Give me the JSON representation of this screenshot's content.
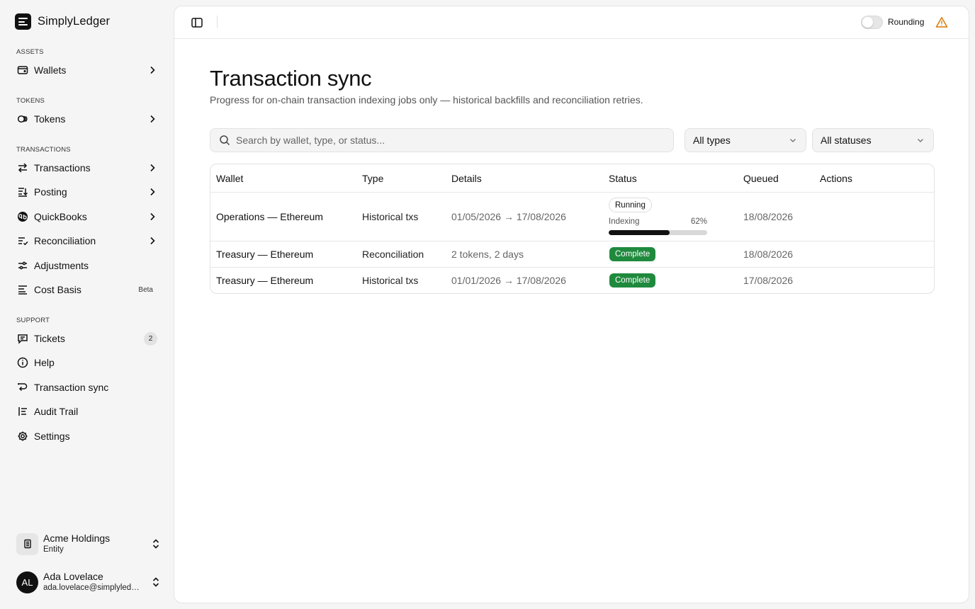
{
  "brand": {
    "name": "SimplyLedger"
  },
  "sidebar": {
    "sections": {
      "assets": "ASSETS",
      "tokens": "TOKENS",
      "transactions": "TRANSACTIONS",
      "support": "SUPPORT"
    },
    "items": {
      "wallets": "Wallets",
      "tokens": "Tokens",
      "transactions": "Transactions",
      "posting": "Posting",
      "quickbooks": "QuickBooks",
      "reconciliation": "Reconciliation",
      "adjustments": "Adjustments",
      "cost_basis": "Cost Basis",
      "cost_basis_badge": "Beta",
      "tickets": "Tickets",
      "tickets_count": "2",
      "help": "Help",
      "transaction_sync": "Transaction sync",
      "audit_trail": "Audit Trail",
      "settings": "Settings"
    },
    "entity": {
      "name": "Acme Holdings",
      "type": "Entity"
    },
    "user": {
      "initials": "AL",
      "name": "Ada Lovelace",
      "email": "ada.lovelace@simplyledger.io"
    }
  },
  "topbar": {
    "rounding_label": "Rounding"
  },
  "page": {
    "title": "Transaction sync",
    "subtitle": "Progress for on-chain transaction indexing jobs only — historical backfills and reconciliation retries."
  },
  "filters": {
    "search_placeholder": "Search by wallet, type, or status...",
    "type_value": "All types",
    "status_value": "All statuses"
  },
  "table": {
    "headers": {
      "wallet": "Wallet",
      "type": "Type",
      "details": "Details",
      "status": "Status",
      "queued": "Queued",
      "actions": "Actions"
    },
    "rows": [
      {
        "wallet": "Operations — Ethereum",
        "type": "Historical txs",
        "details": "01/05/2026 → 17/08/2026",
        "status": "Running",
        "progress_label": "Indexing",
        "progress_text": "62%",
        "progress": 0.62,
        "queued": "18/08/2026"
      },
      {
        "wallet": "Treasury — Ethereum",
        "type": "Reconciliation",
        "details": "2 tokens, 2 days",
        "status": "Complete",
        "queued": "18/08/2026"
      },
      {
        "wallet": "Treasury — Ethereum",
        "type": "Historical txs",
        "details": "01/01/2026 → 17/08/2026",
        "status": "Complete",
        "queued": "17/08/2026"
      }
    ]
  },
  "colors": {
    "complete": "#1f8a3d",
    "warning": "#d97706",
    "progress_fill": "#111111",
    "progress_track": "#d8d8d8"
  }
}
